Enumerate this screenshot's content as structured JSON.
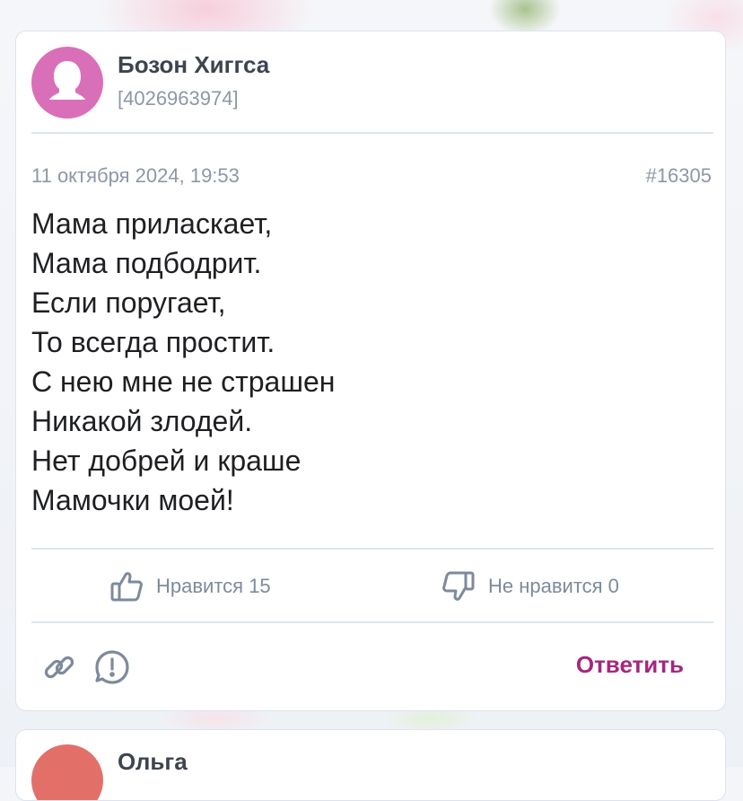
{
  "post": {
    "author_name": "Бозон Хиггса",
    "author_id": "[4026963974]",
    "date": "11 октября 2024, 19:53",
    "post_number": "#16305",
    "lines": [
      "Мама приласкает,",
      "Мама подбодрит.",
      "Если поругает,",
      "То всегда простит.",
      "С нею мне не страшен",
      "Никакой злодей.",
      "Нет добрей и краше",
      "Мамочки моей!"
    ],
    "like_label": "Нравится 15",
    "dislike_label": "Не нравится 0",
    "reply_label": "Ответить",
    "icons": {
      "avatar": "user-silhouette-icon",
      "like": "thumbs-up-icon",
      "dislike": "thumbs-down-icon",
      "link": "link-icon",
      "report": "report-icon"
    },
    "colors": {
      "avatar": "#d96fb8",
      "reply": "#a3287f",
      "muted_text": "#8d97a6"
    }
  },
  "next_post": {
    "author_name": "Ольга",
    "avatar_color": "#e27069"
  }
}
